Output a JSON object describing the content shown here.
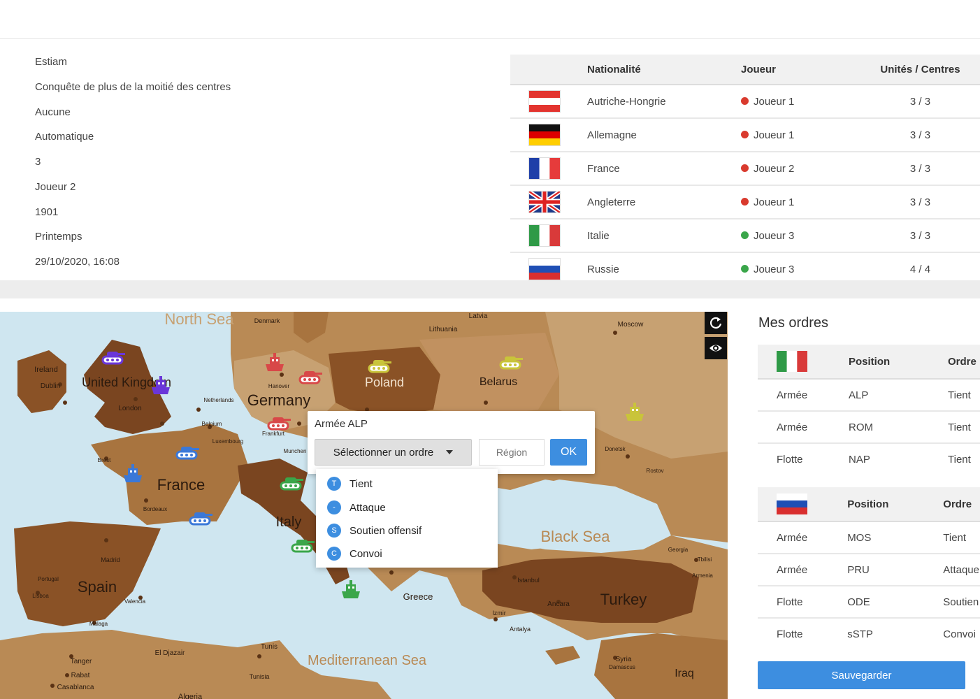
{
  "game_info": [
    "Estiam",
    "Conquête de plus de la moitié des centres",
    "Aucune",
    "Automatique",
    "3",
    "Joueur 2",
    "1901",
    "Printemps",
    "29/10/2020, 16:08"
  ],
  "players_table": {
    "headers": [
      "Nationalité",
      "Joueur",
      "Unités / Centres"
    ],
    "rows": [
      {
        "nation": "Autriche-Hongrie",
        "flag": "austria-flag",
        "player": "Joueur 1",
        "status_color": "#d93a2e",
        "units": "3 / 3"
      },
      {
        "nation": "Allemagne",
        "flag": "germany-flag",
        "player": "Joueur 1",
        "status_color": "#d93a2e",
        "units": "3 / 3"
      },
      {
        "nation": "France",
        "flag": "france-flag",
        "player": "Joueur 2",
        "status_color": "#d93a2e",
        "units": "3 / 3"
      },
      {
        "nation": "Angleterre",
        "flag": "uk-flag",
        "player": "Joueur 1",
        "status_color": "#d93a2e",
        "units": "3 / 3"
      },
      {
        "nation": "Italie",
        "flag": "italy-flag",
        "player": "Joueur 3",
        "status_color": "#3aa64a",
        "units": "3 / 3"
      },
      {
        "nation": "Russie",
        "flag": "russia-flag",
        "player": "Joueur 3",
        "status_color": "#3aa64a",
        "units": "4 / 4"
      }
    ]
  },
  "map": {
    "labels": [
      "North Sea",
      "United Kingdom",
      "London",
      "Ireland",
      "Dublin",
      "Germany",
      "Poland",
      "Belarus",
      "Moscow",
      "Lithuania",
      "Latvia",
      "Denmark",
      "France",
      "Italy",
      "Spain",
      "Black Sea",
      "Turkey",
      "Mediterranean Sea",
      "Iraq",
      "Syria",
      "Greece",
      "Madrid",
      "Luxembourg",
      "Belgium",
      "Hanover",
      "Netherlands",
      "Frankfurt",
      "Munchen",
      "Brest",
      "Bordeaux",
      "Lisboa",
      "Portugal",
      "Valencia",
      "Malaga",
      "Tanger",
      "Rabat",
      "Casablanca",
      "El Djazair",
      "Algeria",
      "Tunis",
      "Tunisia",
      "Istanbul",
      "Ancara",
      "Izmir",
      "Antalya",
      "Rostov",
      "Donetsk",
      "Georgia",
      "Tbilisi",
      "Armenia",
      "Damascus"
    ],
    "refresh_icon": "refresh-icon",
    "eye_icon": "eye-icon"
  },
  "order_popup": {
    "title": "Armée ALP",
    "select_label": "Sélectionner un ordre",
    "region_placeholder": "Région",
    "ok_label": "OK",
    "options": [
      {
        "badge": "T",
        "label": "Tient"
      },
      {
        "badge": "-",
        "label": "Attaque"
      },
      {
        "badge": "S",
        "label": "Soutien offensif"
      },
      {
        "badge": "C",
        "label": "Convoi"
      }
    ]
  },
  "orders": {
    "title": "Mes ordres",
    "headers": [
      "Position",
      "Ordre"
    ],
    "italy": [
      {
        "type": "Armée",
        "position": "ALP",
        "order": "Tient"
      },
      {
        "type": "Armée",
        "position": "ROM",
        "order": "Tient"
      },
      {
        "type": "Flotte",
        "position": "NAP",
        "order": "Tient"
      }
    ],
    "russia": [
      {
        "type": "Armée",
        "position": "MOS",
        "order": "Tient"
      },
      {
        "type": "Armée",
        "position": "PRU",
        "order": "Attaque"
      },
      {
        "type": "Flotte",
        "position": "ODE",
        "order": "Soutien"
      },
      {
        "type": "Flotte",
        "position": "sSTP",
        "order": "Convoi"
      }
    ],
    "save_label": "Sauvegarder"
  },
  "colors": {
    "accent": "#3d8ee0",
    "red_status": "#d93a2e",
    "green_status": "#3aa64a",
    "sea": "#cfe6f0",
    "land": "#b98a55"
  }
}
